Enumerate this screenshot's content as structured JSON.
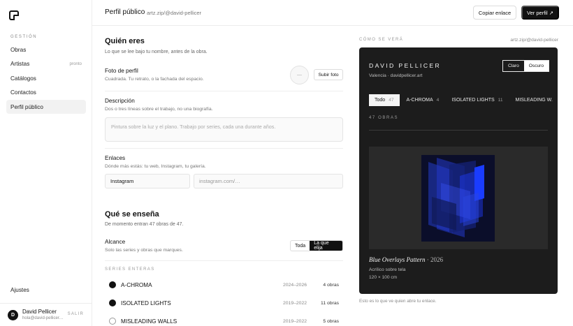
{
  "sidebar": {
    "section_label": "GESTIÓN",
    "items": [
      {
        "label": "Obras",
        "badge": ""
      },
      {
        "label": "Artistas",
        "badge": "pronto"
      },
      {
        "label": "Catálogos",
        "badge": ""
      },
      {
        "label": "Contactos",
        "badge": ""
      },
      {
        "label": "Perfil público",
        "badge": ""
      }
    ],
    "settings_label": "Ajustes",
    "user": {
      "initial": "D",
      "name": "David Pellicer",
      "email": "hola@david-pellicer.art",
      "logout": "SALIR"
    }
  },
  "header": {
    "title": "Perfil público",
    "url": "artz.zip/@david-pellicer",
    "copy_label": "Copiar enlace",
    "view_label": "Ver perfil ↗"
  },
  "form": {
    "who": {
      "title": "Quién eres",
      "subtitle": "Lo que se lee bajo tu nombre, antes de la obra."
    },
    "photo": {
      "label": "Foto de perfil",
      "help": "Cuadrada. Tu retrato, o la fachada del espacio.",
      "placeholder": "—",
      "upload_label": "Subir foto"
    },
    "description": {
      "label": "Descripción",
      "help": "Dos o tres líneas sobre el trabajo, no una biografía.",
      "placeholder": "Pintura sobre la luz y el plano. Trabajo por series, cada una durante años."
    },
    "links": {
      "label": "Enlaces",
      "help": "Dónde más estás: tu web, Instagram, tu galería.",
      "network": "Instagram",
      "url_placeholder": "instagram.com/…"
    },
    "shown": {
      "title": "Qué se enseña",
      "subtitle": "De momento entran 47 obras de 47."
    },
    "scope": {
      "label": "Alcance",
      "help": "Solo las series y obras que marques.",
      "options": [
        "Toda",
        "La que elija"
      ],
      "selected": "La que elija"
    },
    "series_heading": "SERIES ENTERAS",
    "series": [
      {
        "name": "A-CHROMA",
        "years": "2024–2026",
        "count": "4 obras",
        "checked": true
      },
      {
        "name": "ISOLATED LIGHTS",
        "years": "2019–2022",
        "count": "11 obras",
        "checked": true
      },
      {
        "name": "MISLEADING WALLS",
        "years": "2019–2022",
        "count": "5 obras",
        "checked": false
      }
    ]
  },
  "preview": {
    "label": "CÓMO SE VERÁ",
    "url": "artz.zip/@david-pellicer",
    "artist": "DAVID PELLICER",
    "location": "Valencia · davidpellicer.art",
    "themes": [
      "Claro",
      "Oscuro"
    ],
    "theme_selected": "Oscuro",
    "tabs": [
      {
        "label": "Todo",
        "count": "47"
      },
      {
        "label": "A-CHROMA",
        "count": "4"
      },
      {
        "label": "ISOLATED LIGHTS",
        "count": "11"
      },
      {
        "label": "MISLEADING W.",
        "count": ""
      }
    ],
    "works_count": "47 OBRAS",
    "work": {
      "title": "Blue Overlays Pattern",
      "year": " · 2026",
      "medium": "Acrílico sobre tela",
      "dims": "120 × 100 cm"
    },
    "footnote": "Esto es lo que ve quien abre tu enlace.",
    "colors": {
      "bg": "#1c1c1c",
      "art_blue": "#1a3cff"
    }
  }
}
